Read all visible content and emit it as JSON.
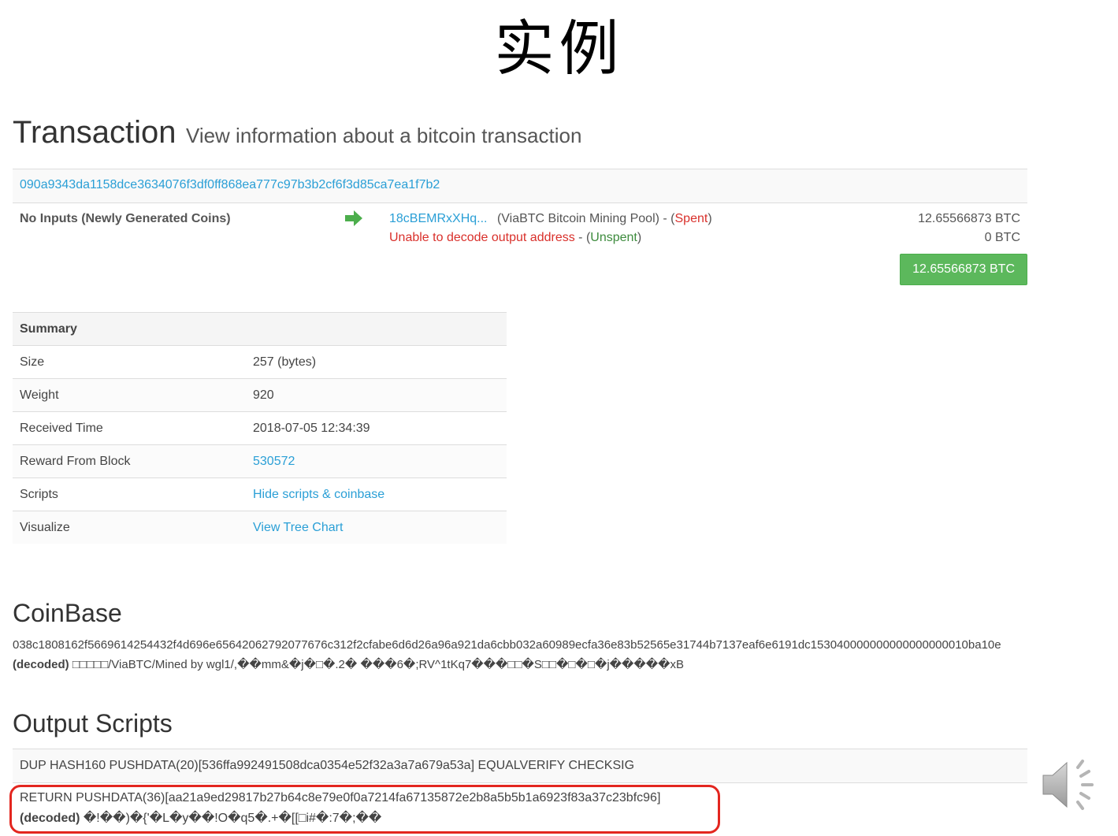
{
  "slide_title": "实例",
  "header": {
    "title": "Transaction",
    "subtitle": "View information about a bitcoin transaction"
  },
  "tx": {
    "hash": "090a9343da1158dce3634076f3df0ff868ea777c97b3b2cf6f3d85ca7ea1f7b2",
    "inputs_label": "No Inputs (Newly Generated Coins)",
    "outputs": [
      {
        "address": "18cBEMRxXHq...",
        "label": "(ViaBTC Bitcoin Mining Pool) - (",
        "status": "Spent",
        "status_close": ")",
        "amount": "12.65566873 BTC"
      },
      {
        "address": "Unable to decode output address",
        "label": " - (",
        "status": "Unspent",
        "status_close": ")",
        "amount": "0 BTC"
      }
    ],
    "total": "12.65566873 BTC"
  },
  "summary": {
    "heading": "Summary",
    "rows": [
      {
        "label": "Size",
        "value": "257 (bytes)"
      },
      {
        "label": "Weight",
        "value": "920"
      },
      {
        "label": "Received Time",
        "value": "2018-07-05 12:34:39"
      },
      {
        "label": "Reward From Block",
        "value": "530572"
      },
      {
        "label": "Scripts",
        "value": "Hide scripts & coinbase"
      },
      {
        "label": "Visualize",
        "value": "View Tree Chart"
      }
    ]
  },
  "coinbase": {
    "heading": "CoinBase",
    "hex": "038c1808162f5669614254432f4d696e65642062792077676c312f2cfabe6d6d26a96a921da6cbb032a60989ecfa36e83b52565e31744b7137eaf6e6191dc153040000000000000000010ba10e",
    "decoded_label": "(decoded)",
    "decoded": " □□□□□/ViaBTC/Mined by wgl1/,��mm&�j�□�.2� ���6�;RV^1tKq7���□□�S□□�□�□�j�����xB"
  },
  "output_scripts": {
    "heading": "Output Scripts",
    "script1": "DUP HASH160 PUSHDATA(20)[536ffa992491508dca0354e52f32a3a7a679a53a] EQUALVERIFY CHECKSIG",
    "script2": "RETURN PUSHDATA(36)[aa21a9ed29817b27b64c8e79e0f0a7214fa67135872e2b8a5b5b1a6923f83a37c23bfc96]",
    "script2_decoded_label": "(decoded)",
    "script2_decoded": " �!��)�{'�L�y��!O�q5�.+�[[□i#�:7�;��"
  },
  "colors": {
    "link": "#2a9fd6",
    "spent": "#d9302b",
    "unspent": "#3d8b3d",
    "total_button": "#5cb85c",
    "highlight": "#e3261f"
  },
  "icons": {
    "arrow": "arrow-right-icon",
    "speaker": "speaker-icon"
  }
}
